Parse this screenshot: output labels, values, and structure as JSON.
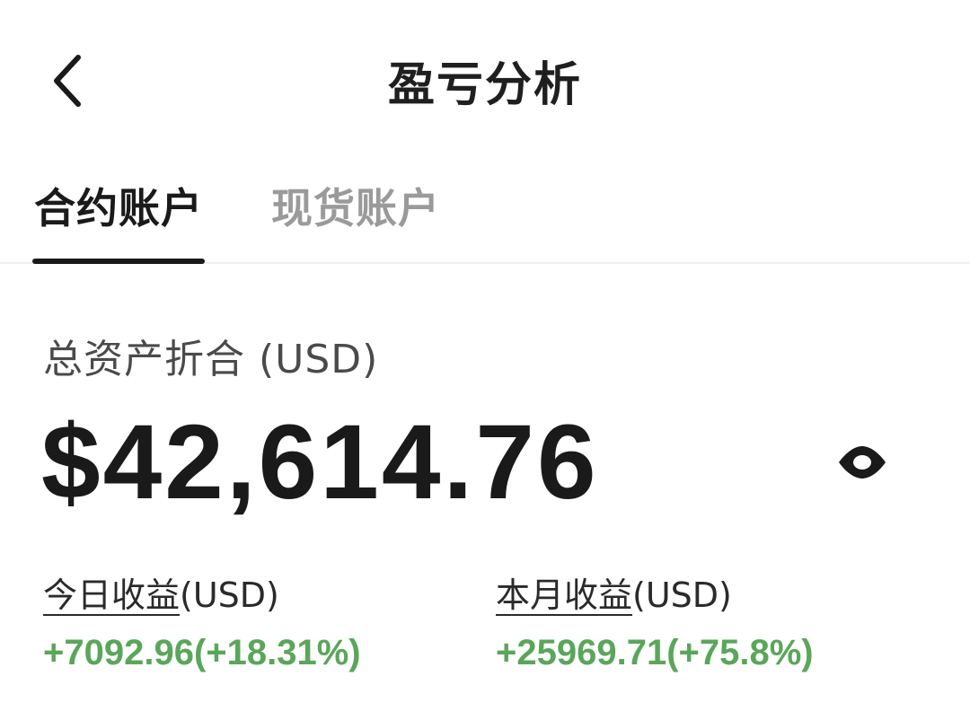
{
  "header": {
    "back_icon": "chevron-left-icon",
    "title": "盈亏分析"
  },
  "tabs": [
    {
      "label": "合约账户",
      "active": true
    },
    {
      "label": "现货账户",
      "active": false
    }
  ],
  "assets": {
    "label": "总资产折合 (USD)",
    "total": "$42,614.76",
    "visibility_icon": "eye-icon"
  },
  "income": {
    "today": {
      "label": "今日收益",
      "unit": "(USD)",
      "value": "+7092.96(+18.31%)"
    },
    "month": {
      "label": "本月收益",
      "unit": "(USD)",
      "value": "+25969.71(+75.8%)"
    }
  },
  "colors": {
    "positive": "#5aa65a",
    "text_primary": "#1a1a1a",
    "text_muted": "#9a9a9a"
  }
}
